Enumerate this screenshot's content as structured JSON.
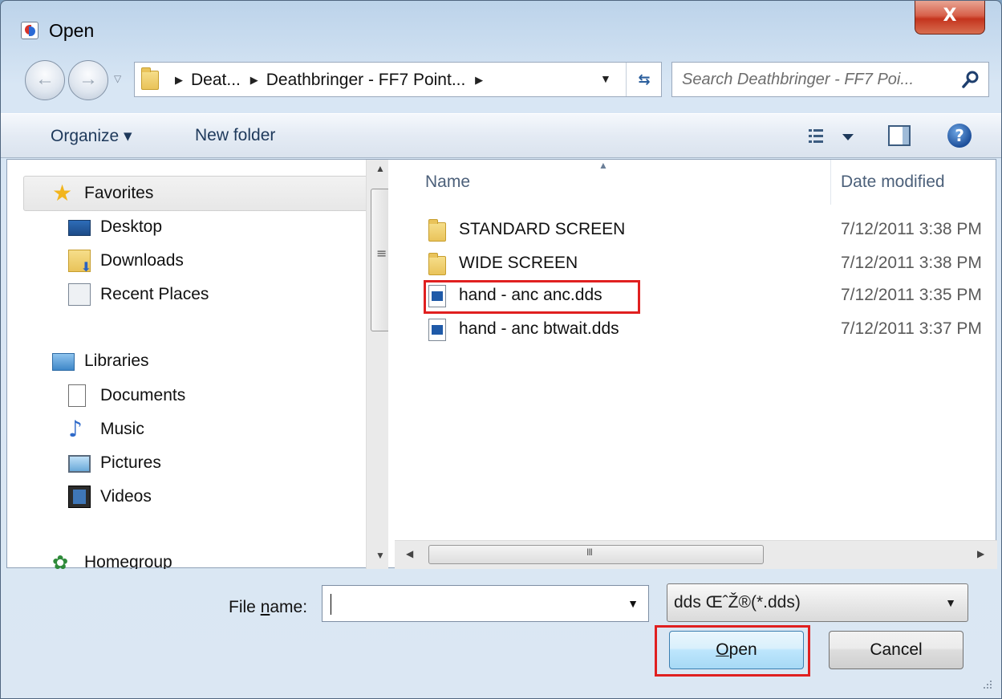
{
  "window": {
    "title": "Open",
    "close_label": "X",
    "app_icon": "dialog-icon"
  },
  "nav": {
    "breadcrumbs": [
      "Deat...",
      "Deathbringer - FF7 Point..."
    ],
    "search_placeholder": "Search Deathbringer - FF7 Poi..."
  },
  "toolbar": {
    "organize_label": "Organize ▾",
    "new_folder_label": "New folder",
    "help_label": "?"
  },
  "sidebar": {
    "favorites": {
      "label": "Favorites",
      "icon": "star-icon"
    },
    "favorite_items": [
      {
        "label": "Desktop",
        "icon": "desktop-icon"
      },
      {
        "label": "Downloads",
        "icon": "downloads-icon"
      },
      {
        "label": "Recent Places",
        "icon": "recent-places-icon"
      }
    ],
    "libraries": {
      "label": "Libraries",
      "icon": "libraries-icon"
    },
    "library_items": [
      {
        "label": "Documents",
        "icon": "documents-icon"
      },
      {
        "label": "Music",
        "icon": "music-icon"
      },
      {
        "label": "Pictures",
        "icon": "pictures-icon"
      },
      {
        "label": "Videos",
        "icon": "videos-icon"
      }
    ],
    "homegroup": {
      "label": "Homegroup",
      "icon": "homegroup-icon"
    }
  },
  "files": {
    "columns": {
      "name": "Name",
      "date": "Date modified"
    },
    "rows": [
      {
        "name": "STANDARD SCREEN",
        "date": "7/12/2011 3:38 PM",
        "type": "folder"
      },
      {
        "name": "WIDE SCREEN",
        "date": "7/12/2011 3:38 PM",
        "type": "folder"
      },
      {
        "name": "hand - anc anc.dds",
        "date": "7/12/2011 3:35 PM",
        "type": "dds",
        "highlighted": true
      },
      {
        "name": "hand - anc btwait.dds",
        "date": "7/12/2011 3:37 PM",
        "type": "dds"
      }
    ]
  },
  "bottom": {
    "file_name_label_pre": "File ",
    "file_name_label_u": "n",
    "file_name_label_post": "ame:",
    "file_name_value": "",
    "file_type_value": "dds ŒˆŽ®(*.dds)",
    "open_label_u": "O",
    "open_label_rest": "pen",
    "cancel_label": "Cancel"
  },
  "colors": {
    "highlight": "#e02020",
    "accent": "#3c7fb1"
  }
}
